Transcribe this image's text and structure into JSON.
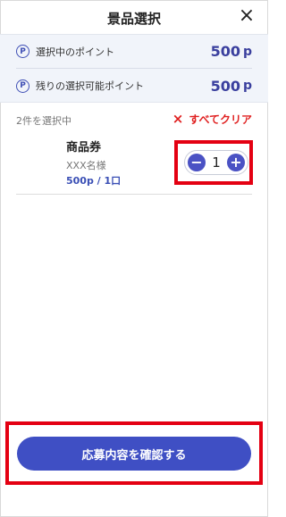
{
  "header": {
    "title": "景品選択",
    "close_icon": "×"
  },
  "points": {
    "icon_letter": "P",
    "rows": [
      {
        "label": "選択中のポイント",
        "value": "500",
        "unit": "p"
      },
      {
        "label": "残りの選択可能ポイント",
        "value": "500",
        "unit": "p"
      }
    ]
  },
  "selection": {
    "count_label": "2件を選択中",
    "clear_icon": "×",
    "clear_label": "すべてクリア"
  },
  "item": {
    "name": "商品券",
    "maker": "XXX名様",
    "price": "500p / 1口",
    "quantity": "1",
    "minus": "−",
    "plus": "+"
  },
  "footer": {
    "confirm_label": "応募内容を確認する"
  },
  "colors": {
    "accent": "#3f4fc4",
    "points_text": "#3a3f9e",
    "clear_red": "#e02020",
    "highlight_red": "#e40012",
    "points_bg": "#f1f4fa"
  }
}
